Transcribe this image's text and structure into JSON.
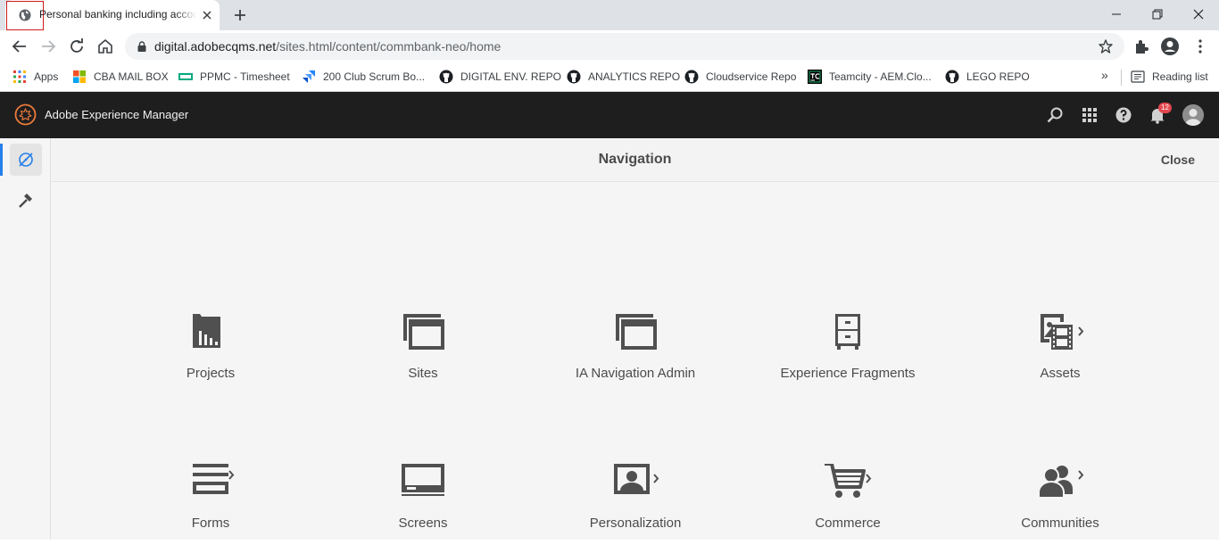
{
  "browser": {
    "tab_title": "Personal banking including accounts, credit cards and home loans",
    "url_host": "digital.adobecqms.net",
    "url_path": "/sites.html/content/commbank-neo/home",
    "bookmarks": [
      {
        "label": "Apps",
        "icon": "apps-grid-icon"
      },
      {
        "label": "CBA MAIL BOX",
        "icon": "microsoft-icon"
      },
      {
        "label": "PPMC - Timesheet",
        "icon": "ppmc-icon"
      },
      {
        "label": "200 Club Scrum Bo...",
        "icon": "jira-icon"
      },
      {
        "label": "DIGITAL ENV. REPO",
        "icon": "github-icon"
      },
      {
        "label": "ANALYTICS REPO",
        "icon": "github-icon"
      },
      {
        "label": "Cloudservice Repo",
        "icon": "github-icon"
      },
      {
        "label": "Teamcity - AEM.Clo...",
        "icon": "teamcity-icon"
      },
      {
        "label": "LEGO REPO",
        "icon": "github-icon"
      }
    ],
    "more_bookmarks": "»",
    "reading_list": "Reading list"
  },
  "aem": {
    "product_name": "Adobe Experience Manager",
    "notification_count": "12",
    "navigation_title": "Navigation",
    "close_label": "Close",
    "tiles": [
      {
        "label": "Projects",
        "icon": "projects-icon",
        "has_children": false
      },
      {
        "label": "Sites",
        "icon": "sites-icon",
        "has_children": false
      },
      {
        "label": "IA Navigation Admin",
        "icon": "ia-navigation-icon",
        "has_children": false
      },
      {
        "label": "Experience Fragments",
        "icon": "experience-fragments-icon",
        "has_children": false
      },
      {
        "label": "Assets",
        "icon": "assets-icon",
        "has_children": true
      },
      {
        "label": "Forms",
        "icon": "forms-icon",
        "has_children": true
      },
      {
        "label": "Screens",
        "icon": "screens-icon",
        "has_children": false
      },
      {
        "label": "Personalization",
        "icon": "personalization-icon",
        "has_children": true
      },
      {
        "label": "Commerce",
        "icon": "commerce-icon",
        "has_children": true
      },
      {
        "label": "Communities",
        "icon": "communities-icon",
        "has_children": true
      }
    ]
  },
  "colors": {
    "aem_header_bg": "#1e1e1e",
    "accent_blue": "#2680eb",
    "badge_red": "#e34850",
    "tile_icon": "#505050"
  }
}
